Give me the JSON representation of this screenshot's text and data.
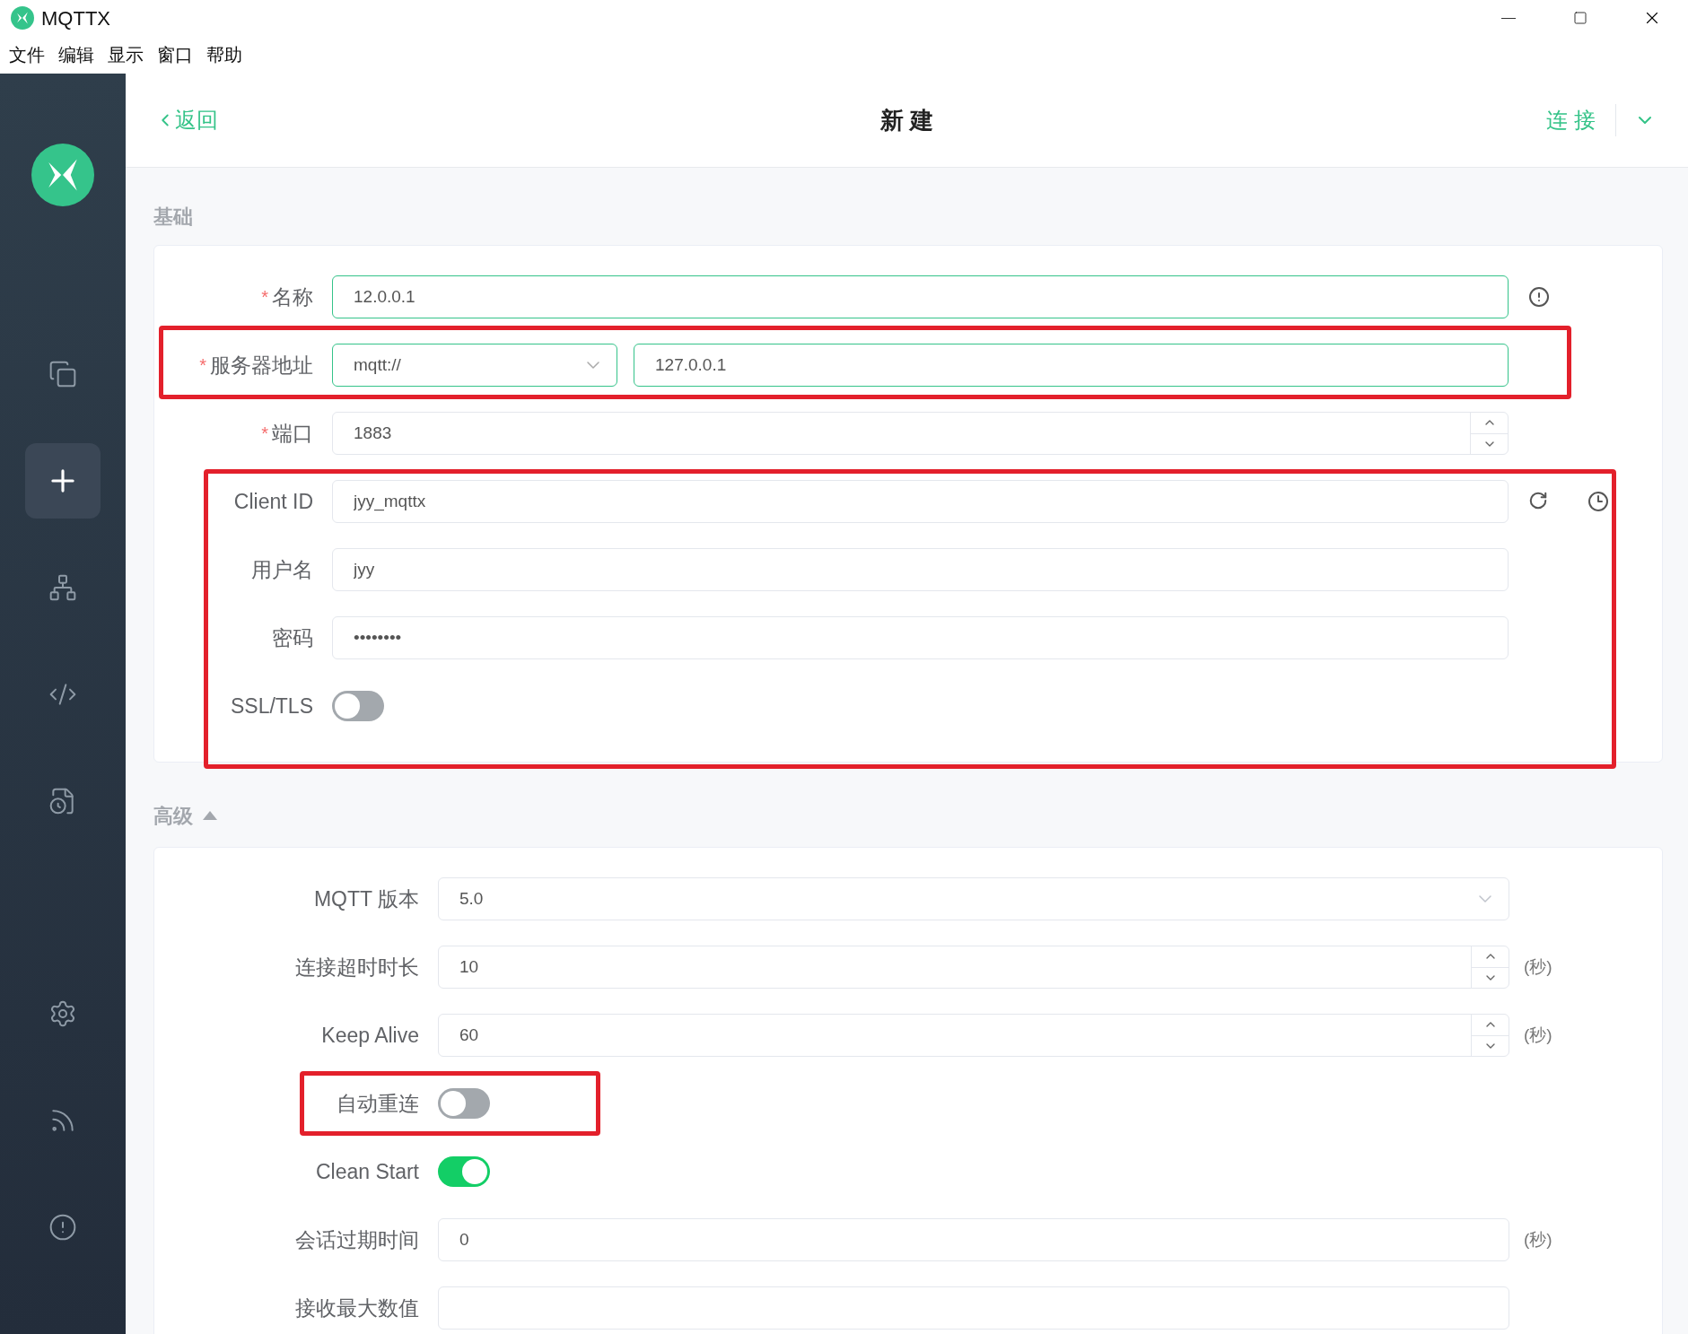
{
  "window": {
    "title": "MQTTX"
  },
  "menu": [
    "文件",
    "编辑",
    "显示",
    "窗口",
    "帮助"
  ],
  "sidebar": {
    "items": [
      {
        "selected": false
      },
      {
        "selected": true
      },
      {
        "selected": false
      },
      {
        "selected": false
      },
      {
        "selected": false
      },
      {
        "selected": false
      },
      {
        "selected": false
      },
      {
        "selected": false
      }
    ]
  },
  "header": {
    "back": "返回",
    "title": "新 建",
    "connect": "连 接"
  },
  "basic": {
    "title": "基础",
    "fields": [
      {
        "kind": "text",
        "label": "名称",
        "required_mark": "*",
        "value": "12.0.0.1",
        "validated": true,
        "annotated": false
      },
      {
        "kind": "address",
        "label": "服务器地址",
        "required_mark": "*",
        "protocol": "mqtt://",
        "value": "127.0.0.1",
        "validated": true,
        "annotated": true
      },
      {
        "kind": "number",
        "label": "端口",
        "required_mark": "*",
        "value": "1883",
        "validated": false,
        "annotated": false
      },
      {
        "kind": "text",
        "label": "Client ID",
        "value": "jyy_mqttx",
        "validated": false,
        "annotated": true
      },
      {
        "kind": "text",
        "label": "用户名",
        "value": "jyy",
        "validated": false,
        "annotated": true
      },
      {
        "kind": "text",
        "label": "密码",
        "value": "••••••••",
        "validated": false,
        "annotated": true
      },
      {
        "kind": "toggle",
        "label": "SSL/TLS",
        "on": false,
        "annotated": true
      }
    ]
  },
  "advanced": {
    "title": "高级",
    "expanded": true,
    "fields": [
      {
        "kind": "select",
        "label": "MQTT 版本",
        "value": "5.0",
        "annotated": false
      },
      {
        "kind": "number",
        "label": "连接超时时长",
        "value": "10",
        "unit": "(秒)",
        "annotated": false
      },
      {
        "kind": "number",
        "label": "Keep Alive",
        "value": "60",
        "unit": "(秒)",
        "annotated": false
      },
      {
        "kind": "toggle",
        "label": "自动重连",
        "on": false,
        "annotated": true
      },
      {
        "kind": "toggle",
        "label": "Clean Start",
        "on": true,
        "annotated": false
      },
      {
        "kind": "text",
        "label": "会话过期时间",
        "value": "0",
        "unit": "(秒)",
        "annotated": false
      },
      {
        "kind": "text",
        "label": "接收最大数值",
        "annotated": false
      }
    ]
  }
}
